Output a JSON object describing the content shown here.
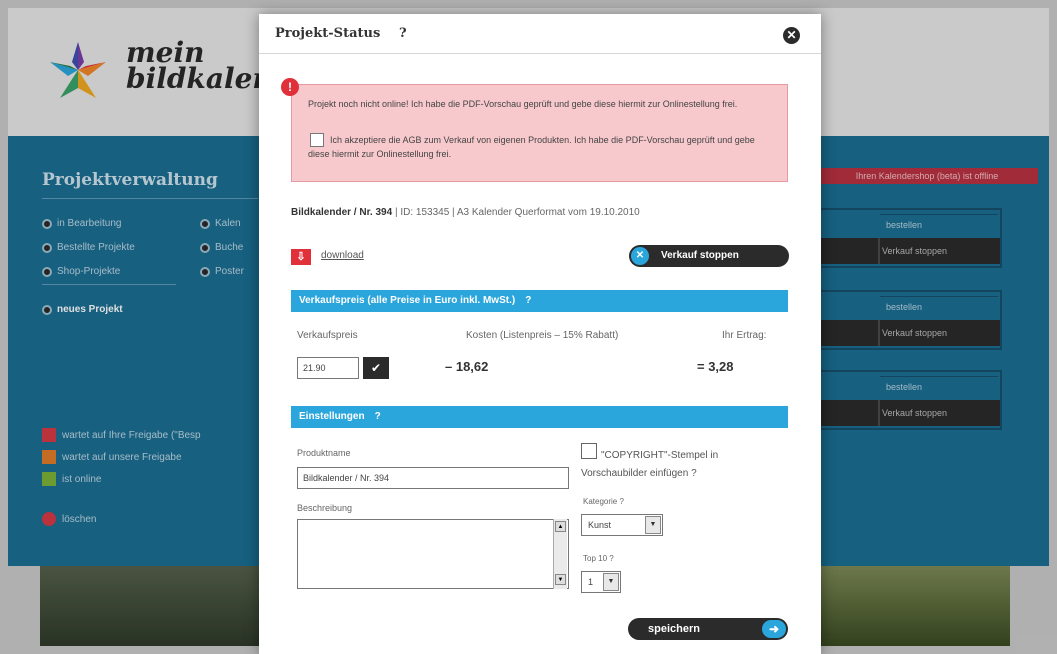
{
  "background": {
    "brand": {
      "line1": "mein",
      "line2": "bildkalen"
    },
    "title": "Projektverwaltung",
    "nav": [
      {
        "label": "in Bearbeitung"
      },
      {
        "label": "Bestellte Projekte"
      },
      {
        "label": "Shop-Projekte"
      },
      {
        "label": "neues Projekt"
      }
    ],
    "nav_col2": [
      "Kalen",
      "Buche",
      "Poster"
    ],
    "legend": [
      {
        "label": "wartet auf Ihre Freigabe (\"Besp",
        "color": "#d33a45"
      },
      {
        "label": "wartet auf unsere Freigabe",
        "color": "#e07a2a"
      },
      {
        "label": "ist online",
        "color": "#7bb13a"
      }
    ],
    "delete_label": "löschen",
    "cta_label": "Ihren Kalendershop (beta) ist offline",
    "boxes": [
      {
        "top": "bestellen",
        "bottom": "Verkauf stoppen"
      },
      {
        "top": "bestellen",
        "bottom": "Verkauf stoppen"
      },
      {
        "top": "bestellen",
        "bottom": "Verkauf stoppen"
      }
    ]
  },
  "modal": {
    "title": "Projekt-Status",
    "help": "?",
    "close_glyph": "✕",
    "alert": {
      "icon": "!",
      "line1": "Projekt noch nicht online! Ich habe die PDF-Vorschau geprüft und gebe diese hiermit zur Onlinestellung frei.",
      "line2": "Ich akzeptiere die AGB zum Verkauf von eigenen Produkten. Ich habe die PDF-Vorschau geprüft und gebe diese hiermit zur Onlinestellung frei."
    },
    "calendar_info": {
      "bold": "Bildkalender / Nr. 394",
      "rest": " | ID: 153345 | A3 Kalender Querformat vom 19.10.2010"
    },
    "download_label": "download",
    "stop_sale_label": "Verkauf stoppen",
    "pricing": {
      "header": "Verkaufspreis (alle Preise in Euro inkl. MwSt.)",
      "help": "?",
      "col_price": "Verkaufspreis",
      "col_cost": "Kosten (Listenpreis – 15% Rabatt)",
      "col_profit": "Ihr Ertrag:",
      "price_value": "21.90",
      "cost_value": "–  18,62",
      "profit_value": "=  3,28"
    },
    "settings": {
      "header": "Einstellungen",
      "help": "?",
      "product_name_label": "Produktname",
      "product_name_value": "Bildkalender / Nr. 394",
      "description_label": "Beschreibung",
      "description_value": "",
      "copyright_label": "\"COPYRIGHT\"-Stempel in Vorschaubilder einfügen ?",
      "category_label": "Kategorie ?",
      "category_value": "Kunst",
      "top10_label": "Top 10 ?",
      "top10_value": "1"
    },
    "save_label": "speichern"
  }
}
